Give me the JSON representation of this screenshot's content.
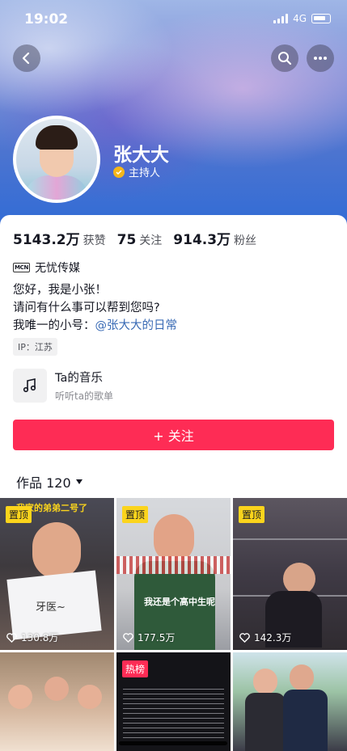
{
  "status_bar": {
    "time": "19:02",
    "network": "4G"
  },
  "profile": {
    "name": "张大大",
    "role": "主持人",
    "stats": [
      {
        "num": "5143.2万",
        "label": "获赞"
      },
      {
        "num": "75",
        "label": "关注"
      },
      {
        "num": "914.3万",
        "label": "粉丝"
      }
    ],
    "org_badge": "MCN",
    "org": "无忧传媒",
    "bio_lines": [
      "您好，我是小张！",
      "请问有什么事可以帮到您吗?"
    ],
    "bio_prefix": "我唯一的小号：",
    "bio_link": "@张大大的日常",
    "ip": "IP：江苏"
  },
  "music": {
    "title": "Ta的音乐",
    "subtitle": "听听ta的歌单"
  },
  "follow_button": "+ 关注",
  "works_tab": {
    "label": "作品 120"
  },
  "videos": [
    {
      "tag": "置顶",
      "tag_type": "pin",
      "likes": "130.8万",
      "caption_top": "我家的弟弟二号了",
      "caption": "牙医~"
    },
    {
      "tag": "置顶",
      "tag_type": "pin",
      "likes": "177.5万",
      "caption": "我还是个高中生呢"
    },
    {
      "tag": "置顶",
      "tag_type": "pin",
      "likes": "142.3万"
    },
    {
      "tag": "",
      "tag_type": "none"
    },
    {
      "tag": "热榜",
      "tag_type": "hot"
    },
    {
      "tag": "",
      "tag_type": "none"
    }
  ],
  "colors": {
    "accent": "#fe2c55",
    "pin_tag": "#fbd41c",
    "link": "#3a6bb5"
  },
  "icons": {
    "back": "chevron-left-icon",
    "search": "search-icon",
    "more": "more-horizontal-icon",
    "verified": "verified-icon",
    "music": "music-note-icon",
    "like": "heart-icon"
  }
}
